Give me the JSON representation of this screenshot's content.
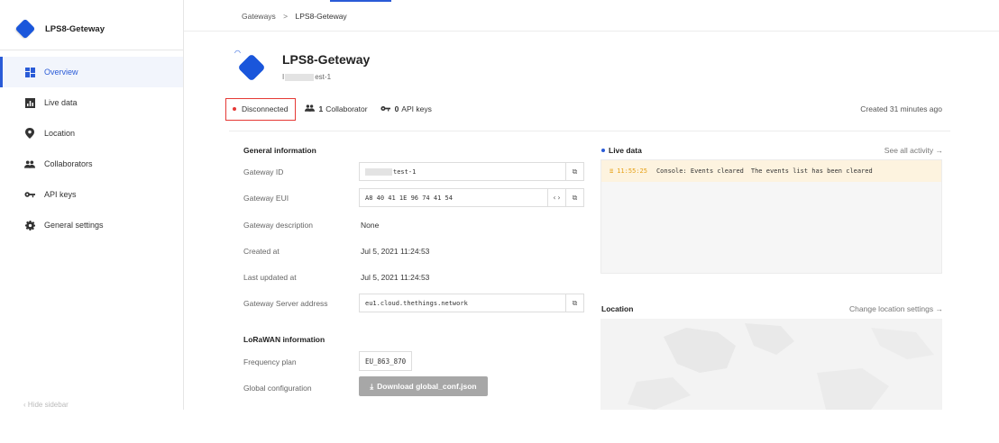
{
  "sidebar": {
    "title": "LPS8-Geteway",
    "items": [
      {
        "label": "Overview",
        "icon": "overview-grid-icon",
        "active": true
      },
      {
        "label": "Live data",
        "icon": "bar-chart-icon",
        "active": false
      },
      {
        "label": "Location",
        "icon": "location-pin-icon",
        "active": false
      },
      {
        "label": "Collaborators",
        "icon": "people-icon",
        "active": false
      },
      {
        "label": "API keys",
        "icon": "key-icon",
        "active": false
      },
      {
        "label": "General settings",
        "icon": "gear-icon",
        "active": false
      }
    ],
    "hide_label": "Hide sidebar"
  },
  "breadcrumb": {
    "root": "Gateways",
    "separator": ">",
    "current": "LPS8-Geteway"
  },
  "gateway": {
    "title": "LPS8-Geteway",
    "id_prefix": "I",
    "id_suffix": "est-1"
  },
  "status": {
    "connection": "Disconnected",
    "collaborators_count": "1",
    "collaborators_label": "Collaborator",
    "api_keys_count": "0",
    "api_keys_label": "API keys",
    "created": "Created 31 minutes ago"
  },
  "general": {
    "title": "General information",
    "fields": {
      "gateway_id_label": "Gateway ID",
      "gateway_id_value": "test-1",
      "gateway_eui_label": "Gateway EUI",
      "gateway_eui_value": "A8 40 41 1E 96 74 41 54",
      "description_label": "Gateway description",
      "description_value": "None",
      "created_label": "Created at",
      "created_value": "Jul 5, 2021 11:24:53",
      "updated_label": "Last updated at",
      "updated_value": "Jul 5, 2021 11:24:53",
      "server_label": "Gateway Server address",
      "server_value": "eu1.cloud.thethings.network"
    }
  },
  "lorawan": {
    "title": "LoRaWAN information",
    "frequency_label": "Frequency plan",
    "frequency_value": "EU_863_870",
    "global_conf_label": "Global configuration",
    "download_label": "Download global_conf.json"
  },
  "live_data": {
    "title": "Live data",
    "link": "See all activity →",
    "events": [
      {
        "time": "11:55:25",
        "type": "Console: Events cleared",
        "message": "The events list has been cleared"
      }
    ]
  },
  "location": {
    "title": "Location",
    "link": "Change location settings →"
  },
  "colors": {
    "accent": "#2a5bd7",
    "status_red": "#e53935",
    "event_orange": "#e7a117"
  }
}
